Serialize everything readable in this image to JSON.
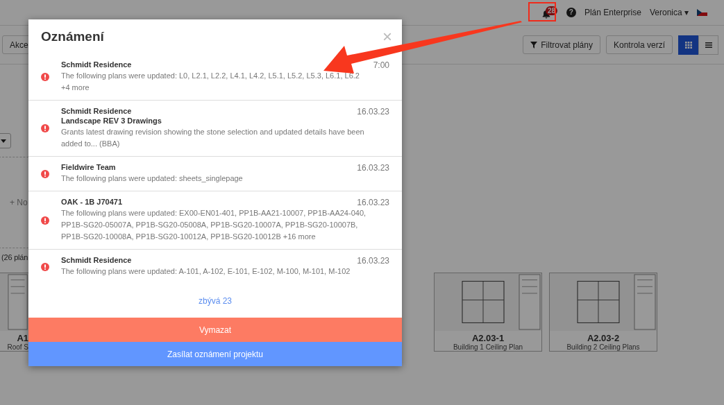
{
  "top_bar": {
    "notification_count": "28",
    "help": "?",
    "plan": "Plán Enterprise",
    "user": "Veronica",
    "caret": "▾"
  },
  "toolbar": {
    "actions": "Akce",
    "filter": "Filtrovat plány",
    "version_check": "Kontrola verzí",
    "views": [
      {
        "kind": "grid",
        "selected": true
      },
      {
        "kind": "list",
        "selected": false
      }
    ]
  },
  "side": {
    "new": "+ No",
    "count": "(26 plán"
  },
  "plans": [
    {
      "number": "A1",
      "name": "Roof S"
    },
    {
      "number": "A2.03-1",
      "name": "Building 1 Ceiling Plan"
    },
    {
      "number": "A2.03-2",
      "name": "Building 2 Ceiling Plans"
    }
  ],
  "modal": {
    "title": "Oznámení",
    "close": "×",
    "items": [
      {
        "title": "Schmidt Residence",
        "body": "The following plans were updated: L0, L2.1, L2.2, L4.1, L4.2, L5.1, L5.2, L5.3, L6.1, L6.2 +4 more",
        "time": "7:00"
      },
      {
        "title": "Schmidt Residence",
        "subtitle": "Landscape REV 3 Drawings",
        "body": "Grants latest drawing revision showing the stone selection and updated details have been added to... (BBA)",
        "time": "16.03.23"
      },
      {
        "title": "Fieldwire Team",
        "body": "The following plans were updated: sheets_singlepage",
        "time": "16.03.23"
      },
      {
        "title": "OAK - 1B J70471",
        "body": "The following plans were updated: EX00-EN01-401, PP1B-AA21-10007, PP1B-AA24-040, PP1B-SG20-05007A, PP1B-SG20-05008A, PP1B-SG20-10007A, PP1B-SG20-10007B, PP1B-SG20-10008A, PP1B-SG20-10012A, PP1B-SG20-10012B +16 more",
        "time": "16.03.23"
      },
      {
        "title": "Schmidt Residence",
        "body": "The following plans were updated: A-101, A-102, E-101, E-102, M-100, M-101, M-102",
        "time": "16.03.23"
      }
    ],
    "remaining": "zbývá 23",
    "clear": "Vymazat",
    "subscribe": "Zasílat oznámení projektu"
  }
}
